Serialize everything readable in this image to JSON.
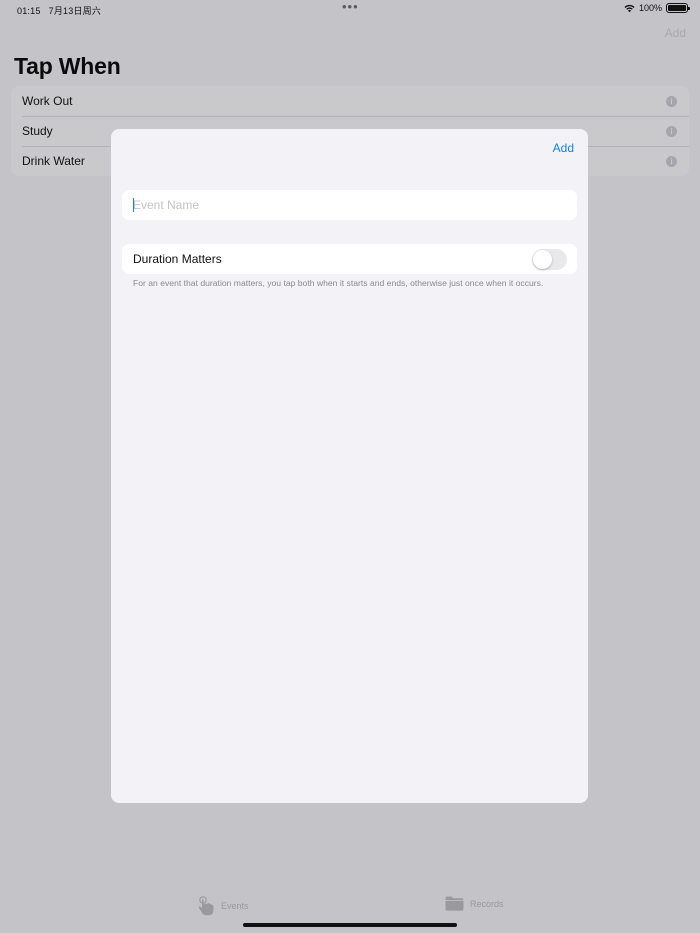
{
  "status_bar": {
    "time": "01:15",
    "date": "7月13日周六",
    "dots": "•••",
    "battery": "100%"
  },
  "background": {
    "add_label": "Add",
    "title": "Tap When",
    "events": [
      {
        "label": "Work Out"
      },
      {
        "label": "Study"
      },
      {
        "label": "Drink Water"
      }
    ]
  },
  "sheet": {
    "add_label": "Add",
    "event_name_placeholder": "Event Name",
    "event_name_value": "",
    "duration_label": "Duration Matters",
    "duration_on": false,
    "footnote": "For an event that duration matters, you tap both when it starts and ends, otherwise just once when it occurs."
  },
  "tab_bar": {
    "tabs": [
      {
        "label": "Events",
        "icon": "hand-tap-icon"
      },
      {
        "label": "Records",
        "icon": "folder-icon"
      }
    ]
  },
  "colors": {
    "accent": "#1a7fdd",
    "dimmed_background": "#c4c4c8",
    "sheet_background": "#f2f2f7"
  }
}
